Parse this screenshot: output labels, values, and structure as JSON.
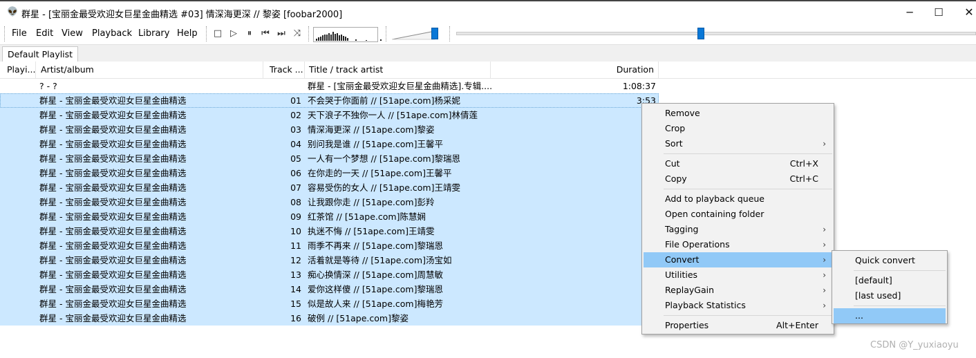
{
  "window": {
    "title": "群星 - [宝丽金最受欢迎女巨星金曲精选 #03] 情深海更深 // 黎姿  [foobar2000]",
    "app_icon": "alien-icon",
    "controls": [
      "─",
      "☐",
      "✕"
    ]
  },
  "menu": [
    "File",
    "Edit",
    "View",
    "Playback",
    "Library",
    "Help"
  ],
  "toolbar_buttons": [
    {
      "name": "stop-icon",
      "glyph": "□"
    },
    {
      "name": "play-icon",
      "glyph": "▷"
    },
    {
      "name": "pause-icon",
      "glyph": "⏸"
    },
    {
      "name": "previous-icon",
      "glyph": "⏮"
    },
    {
      "name": "next-icon",
      "glyph": "⏭"
    },
    {
      "name": "random-icon",
      "glyph": "⤨"
    }
  ],
  "volume_level": 0.9,
  "seek_position": 0.47,
  "playlist_tabs": [
    "Default Playlist"
  ],
  "columns": [
    "Playi...",
    "Artist/album",
    "Track ...",
    "Title / track artist",
    "Duration"
  ],
  "rows": [
    {
      "artist_album": "? - ?",
      "track": "",
      "title": "群星 - [宝丽金最受欢迎女巨星金曲精选].专辑....",
      "duration": "1:08:37",
      "selected": false
    },
    {
      "artist_album": "群星 - 宝丽金最受欢迎女巨星金曲精选",
      "track": "01",
      "title": "不会哭于你面前 // [51ape.com]杨采妮",
      "duration": "3:53",
      "selected": true
    },
    {
      "artist_album": "群星 - 宝丽金最受欢迎女巨星金曲精选",
      "track": "02",
      "title": "天下浪子不独你一人 // [51ape.com]林倩莲",
      "duration": "",
      "selected": true
    },
    {
      "artist_album": "群星 - 宝丽金最受欢迎女巨星金曲精选",
      "track": "03",
      "title": "情深海更深 // [51ape.com]黎姿",
      "duration": "",
      "selected": true
    },
    {
      "artist_album": "群星 - 宝丽金最受欢迎女巨星金曲精选",
      "track": "04",
      "title": "别问我是谁 // [51ape.com]王馨平",
      "duration": "",
      "selected": true
    },
    {
      "artist_album": "群星 - 宝丽金最受欢迎女巨星金曲精选",
      "track": "05",
      "title": "一人有一个梦想 // [51ape.com]黎瑞恩",
      "duration": "",
      "selected": true
    },
    {
      "artist_album": "群星 - 宝丽金最受欢迎女巨星金曲精选",
      "track": "06",
      "title": "在你走的一天 // [51ape.com]王馨平",
      "duration": "",
      "selected": true
    },
    {
      "artist_album": "群星 - 宝丽金最受欢迎女巨星金曲精选",
      "track": "07",
      "title": "容易受伤的女人 // [51ape.com]王靖雯",
      "duration": "",
      "selected": true
    },
    {
      "artist_album": "群星 - 宝丽金最受欢迎女巨星金曲精选",
      "track": "08",
      "title": "让我跟你走 // [51ape.com]彭羚",
      "duration": "",
      "selected": true
    },
    {
      "artist_album": "群星 - 宝丽金最受欢迎女巨星金曲精选",
      "track": "09",
      "title": "红茶馆 // [51ape.com]陈慧娴",
      "duration": "",
      "selected": true
    },
    {
      "artist_album": "群星 - 宝丽金最受欢迎女巨星金曲精选",
      "track": "10",
      "title": "执迷不悔 // [51ape.com]王靖雯",
      "duration": "",
      "selected": true
    },
    {
      "artist_album": "群星 - 宝丽金最受欢迎女巨星金曲精选",
      "track": "11",
      "title": "雨季不再来 // [51ape.com]黎瑞恩",
      "duration": "",
      "selected": true
    },
    {
      "artist_album": "群星 - 宝丽金最受欢迎女巨星金曲精选",
      "track": "12",
      "title": "活着就是等待 // [51ape.com]汤宝如",
      "duration": "",
      "selected": true
    },
    {
      "artist_album": "群星 - 宝丽金最受欢迎女巨星金曲精选",
      "track": "13",
      "title": "痴心换情深 // [51ape.com]周慧敏",
      "duration": "",
      "selected": true
    },
    {
      "artist_album": "群星 - 宝丽金最受欢迎女巨星金曲精选",
      "track": "14",
      "title": "爱你这样傻 // [51ape.com]黎瑞恩",
      "duration": "",
      "selected": true
    },
    {
      "artist_album": "群星 - 宝丽金最受欢迎女巨星金曲精选",
      "track": "15",
      "title": "似是故人来 // [51ape.com]梅艳芳",
      "duration": "",
      "selected": true
    },
    {
      "artist_album": "群星 - 宝丽金最受欢迎女巨星金曲精选",
      "track": "16",
      "title": "破例 // [51ape.com]黎姿",
      "duration": "",
      "selected": true
    }
  ],
  "context_menu": [
    {
      "label": "Remove"
    },
    {
      "label": "Crop"
    },
    {
      "label": "Sort",
      "submenu": true
    },
    {
      "separator": true
    },
    {
      "label": "Cut",
      "shortcut": "Ctrl+X"
    },
    {
      "label": "Copy",
      "shortcut": "Ctrl+C"
    },
    {
      "separator": true
    },
    {
      "label": "Add to playback queue"
    },
    {
      "label": "Open containing folder"
    },
    {
      "label": "Tagging",
      "submenu": true
    },
    {
      "label": "File Operations",
      "submenu": true
    },
    {
      "label": "Convert",
      "submenu": true,
      "highlighted": true
    },
    {
      "label": "Utilities",
      "submenu": true
    },
    {
      "label": "ReplayGain",
      "submenu": true
    },
    {
      "label": "Playback Statistics",
      "submenu": true
    },
    {
      "separator": true
    },
    {
      "label": "Properties",
      "shortcut": "Alt+Enter"
    }
  ],
  "convert_submenu": [
    {
      "label": "Quick convert"
    },
    {
      "separator": true
    },
    {
      "label": "[default]"
    },
    {
      "label": "[last used]"
    },
    {
      "separator": true
    },
    {
      "label": "...",
      "highlighted": true
    }
  ],
  "submenu_arrow": "›",
  "watermark": "CSDN @Y_yuxiaoyu"
}
